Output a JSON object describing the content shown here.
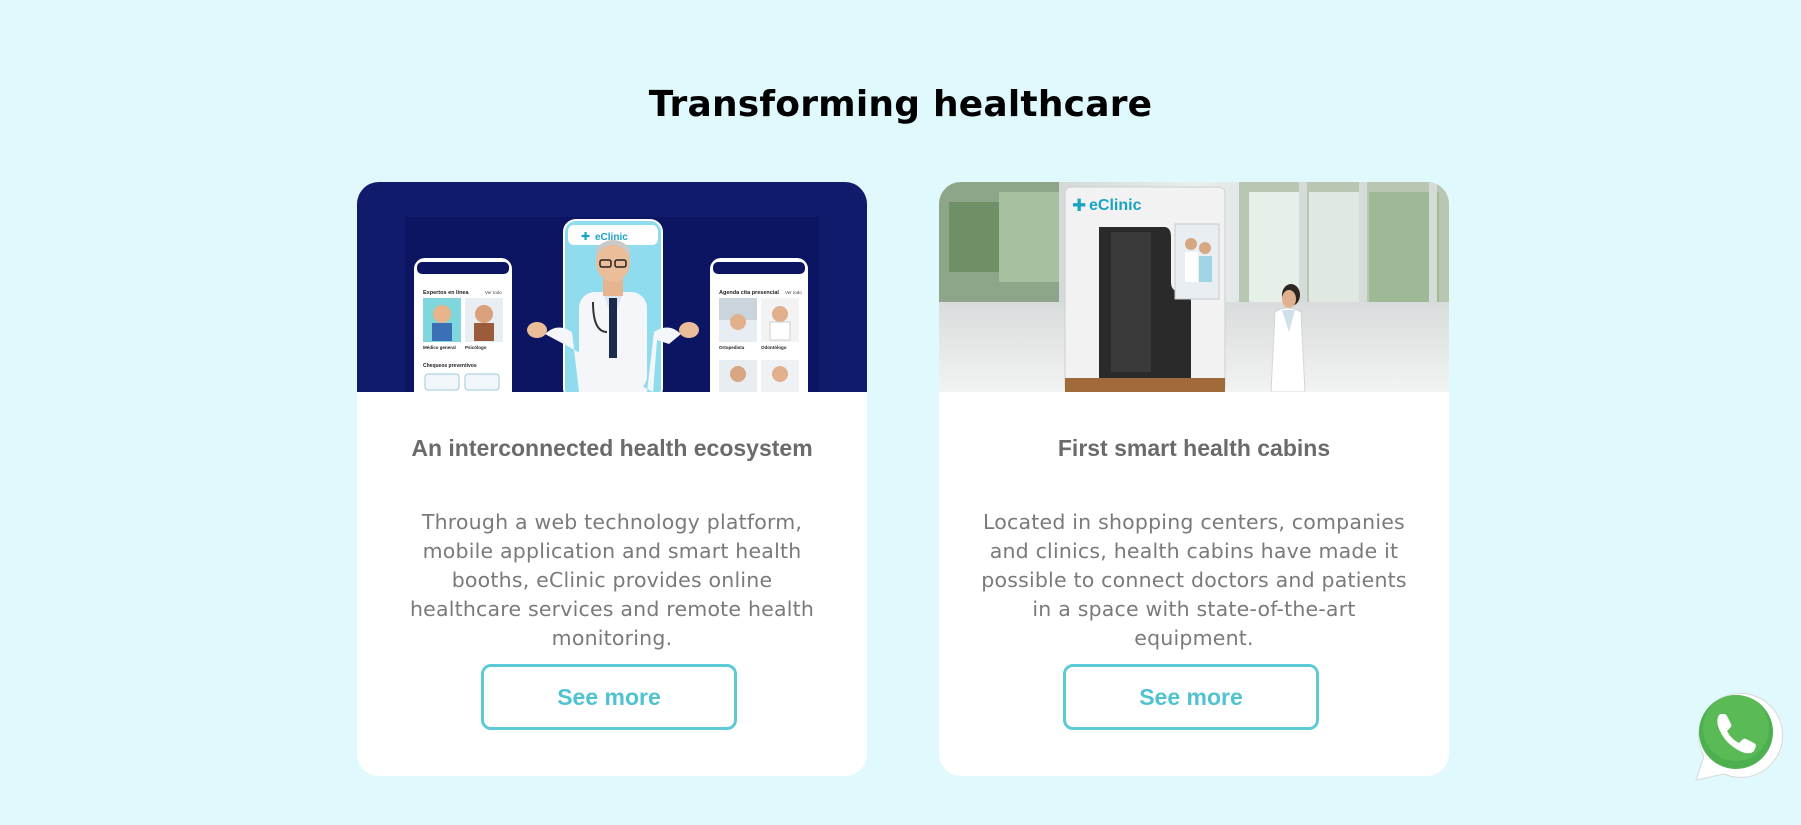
{
  "page": {
    "title": "Transforming healthcare"
  },
  "cards": [
    {
      "title": "An interconnected health ecosystem",
      "description": "Through a web technology platform, mobile application and smart health booths, eClinic provides online healthcare services and remote health monitoring.",
      "button_label": "See more",
      "image": {
        "brand": "eClinic",
        "left_phone_heading": "Expertos en línea",
        "left_phone_link": "Ver todo",
        "left_phone_tile1": "Médico general",
        "left_phone_tile2": "Psicólogo",
        "left_phone_section": "Chequeos preventivos",
        "right_phone_heading": "Agenda cita presencial",
        "right_phone_link": "Ver todo",
        "right_phone_tile1": "Ortopedista",
        "right_phone_tile2": "Odontólogo"
      }
    },
    {
      "title": "First smart health cabins",
      "description": "Located in shopping centers, companies and clinics, health cabins have made it possible to connect doctors and patients in a space with state-of-the-art equipment.",
      "button_label": "See more",
      "image": {
        "brand": "eClinic"
      }
    }
  ],
  "whatsapp": {
    "icon": "whatsapp-icon",
    "color": "#4caf50"
  },
  "colors": {
    "background": "#dff9fd",
    "accent": "#5ccbd6",
    "card_image_navy": "#101b6b"
  }
}
